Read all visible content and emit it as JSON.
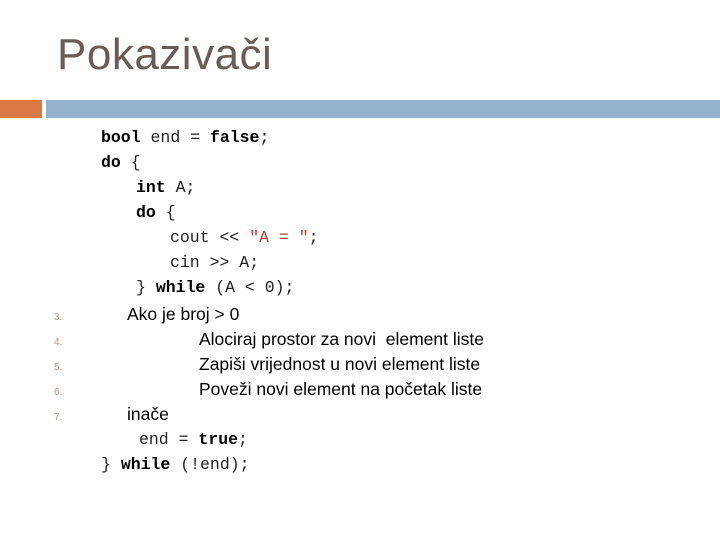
{
  "slide": {
    "title": "Pokazivači",
    "accent_colors": {
      "orange": "#d97a45",
      "blue": "#94b3cf",
      "title": "#6b5b55",
      "string": "#c0392b"
    }
  },
  "code": {
    "l1": {
      "kw1": "bool",
      "t1": " end = ",
      "kw2": "false",
      "t2": ";"
    },
    "l2": {
      "kw": "do",
      "t": " {"
    },
    "l3": {
      "kw": "int",
      "t": " A;"
    },
    "l4": {
      "kw": "do",
      "t": " {"
    },
    "l5": {
      "t1": "cout << ",
      "str": "\"A = \"",
      "t2": ";"
    },
    "l6": {
      "t": "cin >> A;"
    },
    "l7": {
      "t1": "} ",
      "kw": "while",
      "t2": " (A < 0);"
    },
    "l12": {
      "t1": "end = ",
      "kw": "true",
      "t2": ";"
    },
    "l13": {
      "t1": "} ",
      "kw": "while",
      "t2": " (!end);"
    }
  },
  "steps": [
    {
      "num": "3.",
      "text": "Ako je broj > 0"
    },
    {
      "num": "4.",
      "text": "Alociraj prostor za novi  element liste"
    },
    {
      "num": "5.",
      "text": "Zapiši vrijednost u novi element liste"
    },
    {
      "num": "6.",
      "text": "Poveži novi element na početak liste"
    },
    {
      "num": "7.",
      "text": "inače"
    }
  ]
}
